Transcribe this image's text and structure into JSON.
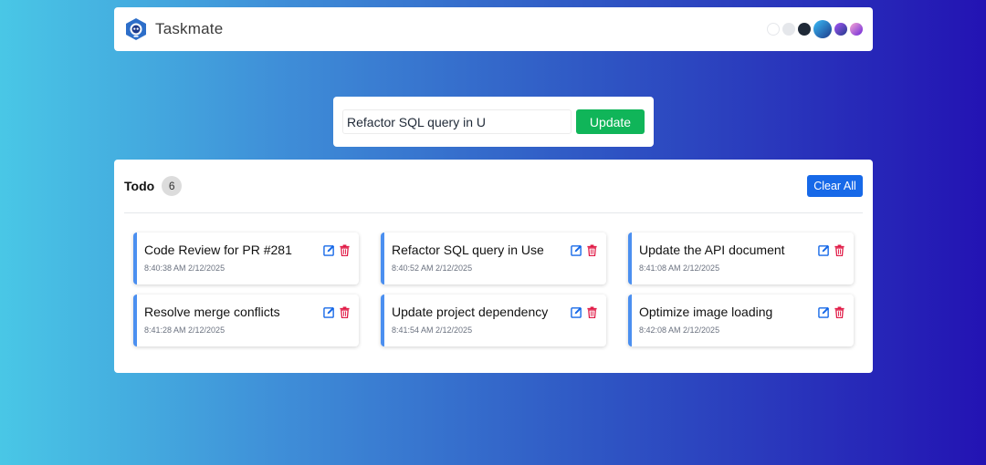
{
  "app": {
    "name": "Taskmate"
  },
  "themes": [
    {
      "name": "light",
      "color": "#ffffff"
    },
    {
      "name": "light-gray",
      "color": "#e5e7eb"
    },
    {
      "name": "dark",
      "color": "#1f2937"
    },
    {
      "name": "blue-gradient",
      "color": "#2563eb"
    },
    {
      "name": "purple-gradient",
      "color": "#6d28d9"
    },
    {
      "name": "pink-gradient",
      "color": "#c026d3"
    }
  ],
  "editor": {
    "value": "Refactor SQL query in U",
    "button_label": "Update"
  },
  "todo": {
    "title": "Todo",
    "count": "6",
    "clear_label": "Clear All",
    "items": [
      {
        "title": "Code Review for PR #281",
        "time": "8:40:38 AM 2/12/2025"
      },
      {
        "title": "Refactor SQL query in Use",
        "time": "8:40:52 AM 2/12/2025"
      },
      {
        "title": "Update the API document",
        "time": "8:41:08 AM 2/12/2025"
      },
      {
        "title": "Resolve merge conflicts",
        "time": "8:41:28 AM 2/12/2025"
      },
      {
        "title": "Update project dependency",
        "time": "8:41:54 AM 2/12/2025"
      },
      {
        "title": "Optimize image loading",
        "time": "8:42:08 AM 2/12/2025"
      }
    ]
  },
  "colors": {
    "accent": "#1769e8",
    "update": "#10b559",
    "delete": "#e11d48",
    "card_border": "#4b8ff0"
  }
}
